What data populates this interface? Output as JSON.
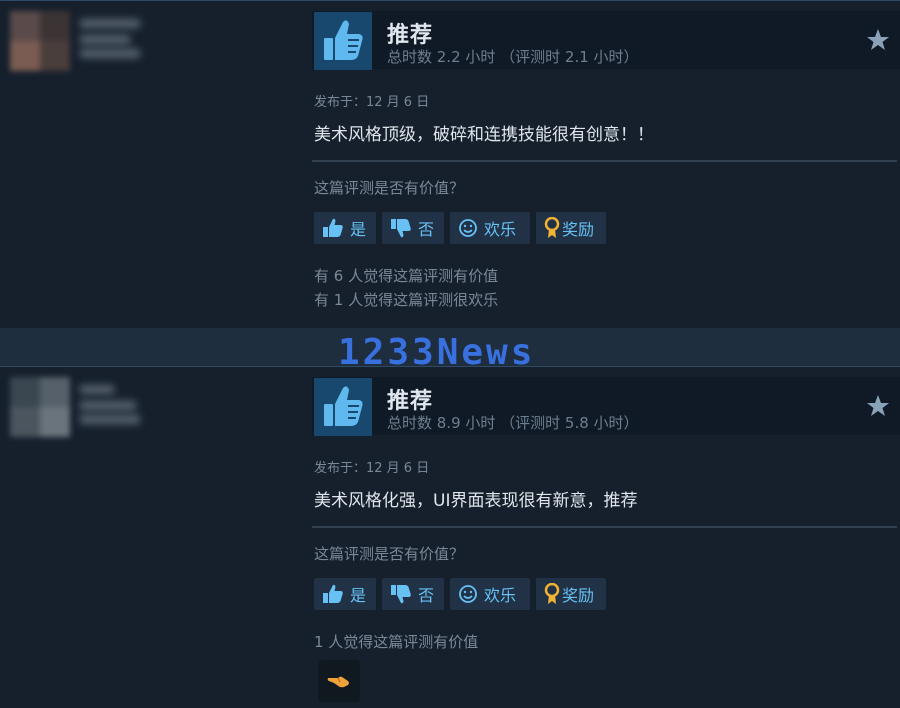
{
  "reviews": [
    {
      "recommendation": "推荐",
      "hours": "总时数 2.2 小时 （评测时 2.1 小时）",
      "posted": "发布于：12 月 6 日",
      "text": "美术风格顶级，破碎和连携技能很有创意！！",
      "helpful_question": "这篇评测是否有价值？",
      "buttons": {
        "yes": "是",
        "no": "否",
        "funny": "欢乐",
        "award": "奖励"
      },
      "counts": [
        "有 6 人觉得这篇评测有价值",
        "有 1 人觉得这篇评测很欢乐"
      ]
    },
    {
      "recommendation": "推荐",
      "hours": "总时数 8.9 小时 （评测时 5.8 小时）",
      "posted": "发布于：12 月 6 日",
      "text": "美术风格化强，UI界面表现很有新意，推荐",
      "helpful_question": "这篇评测是否有价值？",
      "buttons": {
        "yes": "是",
        "no": "否",
        "funny": "欢乐",
        "award": "奖励"
      },
      "counts": [
        "1 人觉得这篇评测有价值"
      ]
    }
  ],
  "watermark": "1233News",
  "colors": {
    "background": "#1b2838",
    "review_bg": "#16202d",
    "accent_link": "#67c1f5",
    "thumb_bg": "#18486e",
    "award_gold": "#f2b233"
  },
  "icons": {
    "thumbs_up": "thumbs-up-icon",
    "thumbs_down": "thumbs-down-icon",
    "smiley": "smiley-icon",
    "award": "award-ribbon-icon",
    "star": "star-icon",
    "pointing_hand": "pointing-hand-award-icon"
  }
}
